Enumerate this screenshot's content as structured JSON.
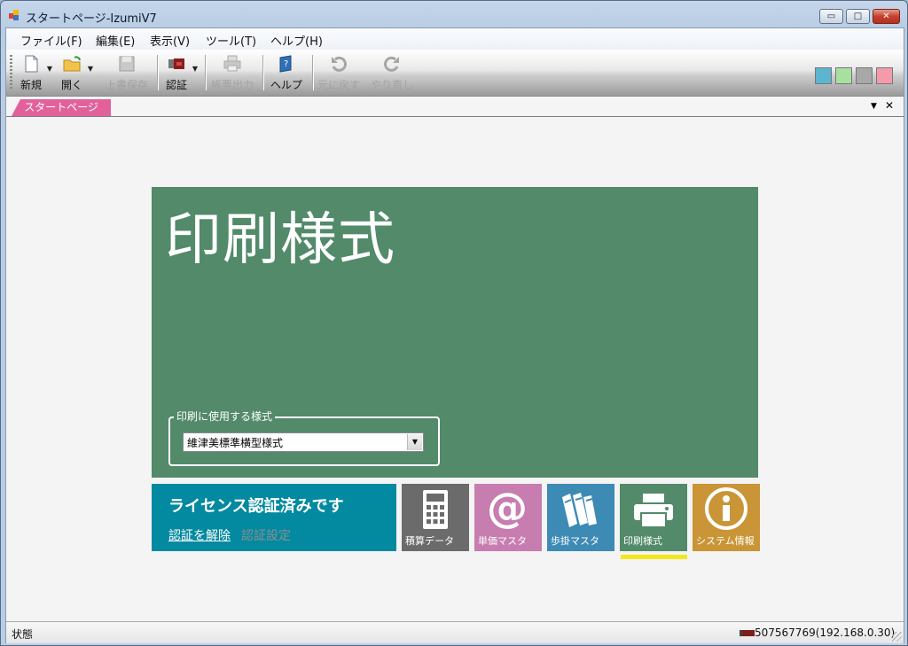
{
  "window": {
    "title": "スタートページ-IzumiV7",
    "minimize_label": "▭",
    "maximize_label": "□",
    "close_label": "✕"
  },
  "menubar": {
    "items": [
      {
        "label": "ファイル(F)"
      },
      {
        "label": "編集(E)"
      },
      {
        "label": "表示(V)"
      },
      {
        "label": "ツール(T)"
      },
      {
        "label": "ヘルプ(H)"
      }
    ]
  },
  "toolbar": {
    "new_label": "新規",
    "open_label": "開く",
    "save_label": "上書保存",
    "auth_label": "認証",
    "print_label": "帳票出力",
    "help_label": "ヘルプ",
    "undo_label": "元に戻す",
    "redo_label": "やり直し",
    "dropdown_arrow": "▼",
    "theme_colors": [
      "#5bb5d0",
      "#a8e0a0",
      "#a8a8a8",
      "#f59aaa"
    ]
  },
  "tabs": {
    "active_label": "スタートページ",
    "menu_glyph": "▼",
    "close_glyph": "✕"
  },
  "hero": {
    "title": "印刷様式",
    "group_label": "印刷に使用する様式",
    "select_value": "維津美標準横型様式",
    "select_arrow": "▼",
    "background": "#528a6a"
  },
  "license": {
    "status": "ライセンス認証済みです",
    "unlock_link": "認証を解除",
    "settings_link": "認証設定"
  },
  "tiles": [
    {
      "label": "積算データ",
      "icon": "calculator-icon",
      "color": "#6b6b6b"
    },
    {
      "label": "単価マスタ",
      "icon": "at-sign-icon",
      "color": "#c77db0"
    },
    {
      "label": "歩掛マスタ",
      "icon": "books-icon",
      "color": "#3d8ab5"
    },
    {
      "label": "印刷様式",
      "icon": "printer-icon",
      "color": "#528a6a",
      "selected": true
    },
    {
      "label": "システム情報",
      "icon": "info-icon",
      "color": "#c99536"
    }
  ],
  "statusbar": {
    "status_text": "状態",
    "connection_text": "507567769(192.168.0.30)"
  }
}
